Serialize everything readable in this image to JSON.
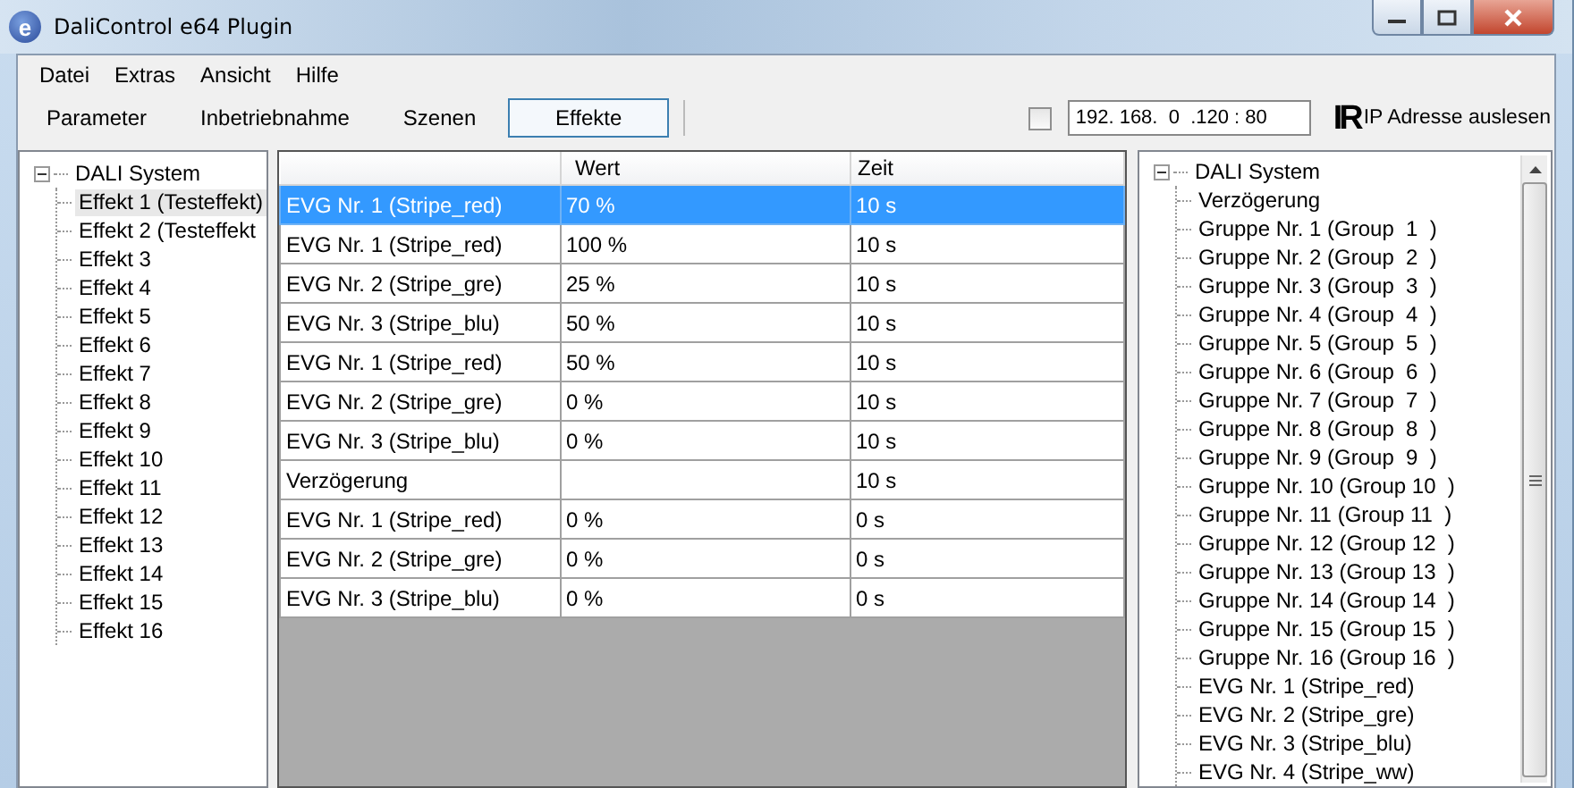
{
  "window": {
    "title": "DaliControl e64 Plugin",
    "icon_letter": "e"
  },
  "menu": [
    "Datei",
    "Extras",
    "Ansicht",
    "Hilfe"
  ],
  "toolbar": {
    "tabs": [
      {
        "label": "Parameter",
        "selected": false
      },
      {
        "label": "Inbetriebnahme",
        "selected": false
      },
      {
        "label": "Szenen",
        "selected": false
      },
      {
        "label": "Effekte",
        "selected": true
      }
    ],
    "ip_checkbox": {
      "checked": false
    },
    "ip_address": "192. 168.  0  .120 : 80",
    "ip_logo": "IR",
    "ip_read_label": "IP Adresse auslesen"
  },
  "left_tree": {
    "root": "DALI System",
    "expanded": true,
    "children": [
      {
        "label": "Effekt 1 (Testeffekt)",
        "selected": true
      },
      {
        "label": "Effekt 2 (Testeffekt",
        "selected": false
      },
      {
        "label": "Effekt 3",
        "selected": false
      },
      {
        "label": "Effekt 4",
        "selected": false
      },
      {
        "label": "Effekt 5",
        "selected": false
      },
      {
        "label": "Effekt 6",
        "selected": false
      },
      {
        "label": "Effekt 7",
        "selected": false
      },
      {
        "label": "Effekt 8",
        "selected": false
      },
      {
        "label": "Effekt 9",
        "selected": false
      },
      {
        "label": "Effekt 10",
        "selected": false
      },
      {
        "label": "Effekt 11",
        "selected": false
      },
      {
        "label": "Effekt 12",
        "selected": false
      },
      {
        "label": "Effekt 13",
        "selected": false
      },
      {
        "label": "Effekt 14",
        "selected": false
      },
      {
        "label": "Effekt 15",
        "selected": false
      },
      {
        "label": "Effekt 16",
        "selected": false
      }
    ]
  },
  "table": {
    "columns": [
      "",
      "Wert",
      "Zeit"
    ],
    "rows": [
      {
        "cells": [
          "EVG Nr. 1 (Stripe_red)",
          "70 %",
          "10 s"
        ],
        "selected": true
      },
      {
        "cells": [
          "EVG Nr. 1 (Stripe_red)",
          "100 %",
          "10 s"
        ],
        "selected": false
      },
      {
        "cells": [
          "EVG Nr. 2 (Stripe_gre)",
          "25 %",
          "10 s"
        ],
        "selected": false
      },
      {
        "cells": [
          "EVG Nr. 3 (Stripe_blu)",
          "50 %",
          "10 s"
        ],
        "selected": false
      },
      {
        "cells": [
          "EVG Nr. 1 (Stripe_red)",
          "50 %",
          "10 s"
        ],
        "selected": false
      },
      {
        "cells": [
          "EVG Nr. 2 (Stripe_gre)",
          "0 %",
          "10 s"
        ],
        "selected": false
      },
      {
        "cells": [
          "EVG Nr. 3 (Stripe_blu)",
          "0 %",
          "10 s"
        ],
        "selected": false
      },
      {
        "cells": [
          "Verzögerung",
          "",
          "10 s"
        ],
        "selected": false
      },
      {
        "cells": [
          "EVG Nr. 1 (Stripe_red)",
          "0 %",
          "0 s"
        ],
        "selected": false
      },
      {
        "cells": [
          "EVG Nr. 2 (Stripe_gre)",
          "0 %",
          "0 s"
        ],
        "selected": false
      },
      {
        "cells": [
          "EVG Nr. 3 (Stripe_blu)",
          "0 %",
          "0 s"
        ],
        "selected": false
      }
    ]
  },
  "right_tree": {
    "root": "DALI System",
    "expanded": true,
    "children": [
      {
        "label": "Verzögerung"
      },
      {
        "label": "Gruppe Nr. 1 (Group  1  )"
      },
      {
        "label": "Gruppe Nr. 2 (Group  2  )"
      },
      {
        "label": "Gruppe Nr. 3 (Group  3  )"
      },
      {
        "label": "Gruppe Nr. 4 (Group  4  )"
      },
      {
        "label": "Gruppe Nr. 5 (Group  5  )"
      },
      {
        "label": "Gruppe Nr. 6 (Group  6  )"
      },
      {
        "label": "Gruppe Nr. 7 (Group  7  )"
      },
      {
        "label": "Gruppe Nr. 8 (Group  8  )"
      },
      {
        "label": "Gruppe Nr. 9 (Group  9  )"
      },
      {
        "label": "Gruppe Nr. 10 (Group 10  )"
      },
      {
        "label": "Gruppe Nr. 11 (Group 11  )"
      },
      {
        "label": "Gruppe Nr. 12 (Group 12  )"
      },
      {
        "label": "Gruppe Nr. 13 (Group 13  )"
      },
      {
        "label": "Gruppe Nr. 14 (Group 14  )"
      },
      {
        "label": "Gruppe Nr. 15 (Group 15  )"
      },
      {
        "label": "Gruppe Nr. 16 (Group 16  )"
      },
      {
        "label": "EVG Nr. 1 (Stripe_red)"
      },
      {
        "label": "EVG Nr. 2 (Stripe_gre)"
      },
      {
        "label": "EVG Nr. 3 (Stripe_blu)"
      },
      {
        "label": "EVG Nr. 4 (Stripe_ww)"
      }
    ]
  }
}
